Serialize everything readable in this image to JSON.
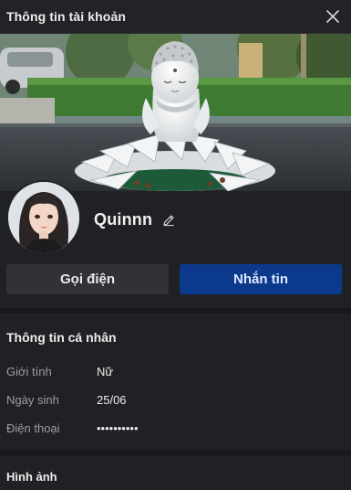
{
  "header": {
    "title": "Thông tin tài khoản",
    "close_icon": "close-icon"
  },
  "profile": {
    "display_name": "Quinnn",
    "edit_icon": "pencil-icon"
  },
  "actions": {
    "call_label": "Gọi điện",
    "message_label": "Nhắn tin"
  },
  "personal_info": {
    "title": "Thông tin cá nhân",
    "rows": [
      {
        "label": "Giới tính",
        "value": "Nữ"
      },
      {
        "label": "Ngày sinh",
        "value": "25/06"
      },
      {
        "label": "Điện thoại",
        "value": "••••••••••"
      }
    ]
  },
  "images": {
    "title": "Hình ảnh"
  },
  "colors": {
    "background": "#202124",
    "message_button": "#0b3a8c",
    "call_button": "#303236"
  }
}
